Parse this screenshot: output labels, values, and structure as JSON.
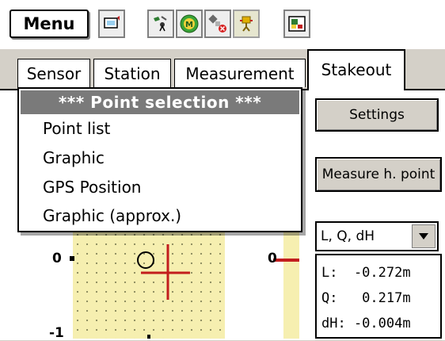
{
  "toolbar": {
    "menu_label": "Menu",
    "icons": [
      "display-icon",
      "instrument-icon",
      "m-circle-icon",
      "satellite-icon",
      "robot-icon",
      "map-icon"
    ]
  },
  "tabs": [
    {
      "label": "Sensor"
    },
    {
      "label": "Station"
    },
    {
      "label": "Measurement"
    },
    {
      "label": "Stakeout",
      "active": true
    }
  ],
  "stakeout": {
    "settings_label": "Settings",
    "measure_label": "Measure h. point",
    "mode_select": "L, Q, dH",
    "readout": {
      "L": "L:  -0.272m",
      "Q": "Q:   0.217m",
      "dH": "dH: -0.004m"
    }
  },
  "graph": {
    "left_ticks": [
      "0",
      "-1"
    ],
    "mid_tick": "0"
  },
  "popup": {
    "title": "*** Point selection ***",
    "items": [
      "Point list",
      "Graphic",
      "GPS Position",
      "Graphic (approx.)"
    ]
  },
  "colors": {
    "popup_title_bg": "#7a7a7a",
    "graph_bg": "#f6efb0",
    "target_cross": "#c21d1d"
  }
}
